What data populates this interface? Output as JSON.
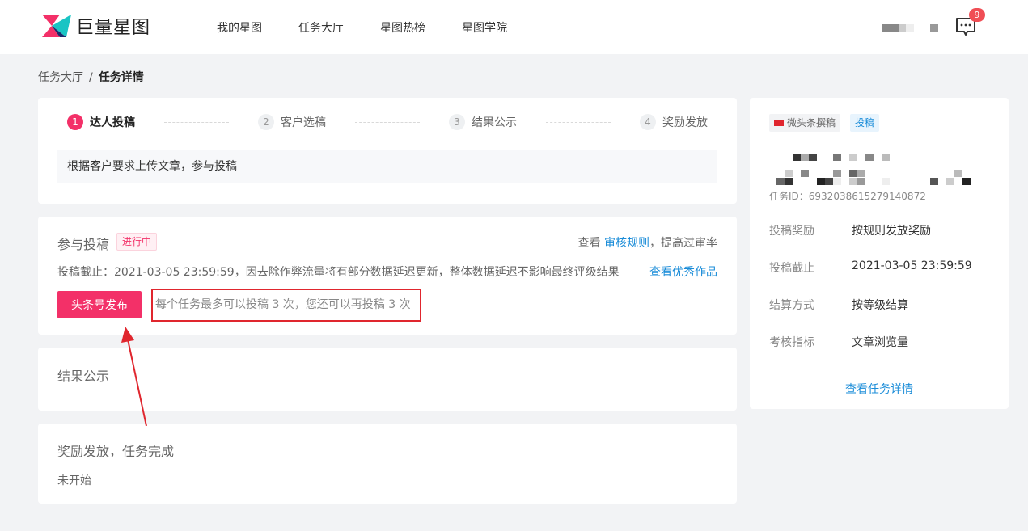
{
  "header": {
    "logo_text": "巨量星图",
    "nav": [
      "我的星图",
      "任务大厅",
      "星图热榜",
      "星图学院"
    ],
    "message_badge": "9"
  },
  "breadcrumb": {
    "parent": "任务大厅",
    "separator": "/",
    "current": "任务详情"
  },
  "steps": {
    "items": [
      {
        "num": "1",
        "label": "达人投稿"
      },
      {
        "num": "2",
        "label": "客户选稿"
      },
      {
        "num": "3",
        "label": "结果公示"
      },
      {
        "num": "4",
        "label": "奖励发放"
      }
    ],
    "description": "根据客户要求上传文章，参与投稿"
  },
  "submission": {
    "title": "参与投稿",
    "status": "进行中",
    "rule_prefix": "查看",
    "rule_link": "审核规则",
    "rule_suffix": "，提高过审率",
    "deadline_text": "投稿截止：2021-03-05 23:59:59，因去除作弊流量将有部分数据延迟更新，整体数据延迟不影响最终评级结果",
    "excellent_link": "查看优秀作品",
    "publish_button": "头条号发布",
    "limit_text": "每个任务最多可以投稿 3 次，您还可以再投稿 3 次"
  },
  "result": {
    "title": "结果公示"
  },
  "reward": {
    "title": "奖励发放，任务完成",
    "status": "未开始"
  },
  "task_info": {
    "type_tag": "微头条撰稿",
    "mode_tag": "投稿",
    "task_id": "任务ID：6932038615279140872",
    "rows": [
      {
        "label": "投稿奖励",
        "value": "按规则发放奖励"
      },
      {
        "label": "投稿截止",
        "value": "2021-03-05 23:59:59"
      },
      {
        "label": "结算方式",
        "value": "按等级结算"
      },
      {
        "label": "考核指标",
        "value": "文章浏览量"
      }
    ],
    "detail_link": "查看任务详情"
  },
  "colors": {
    "brand_pink": "#f33068",
    "link_blue": "#1a8cd8",
    "annotation_red": "#e0262e"
  }
}
